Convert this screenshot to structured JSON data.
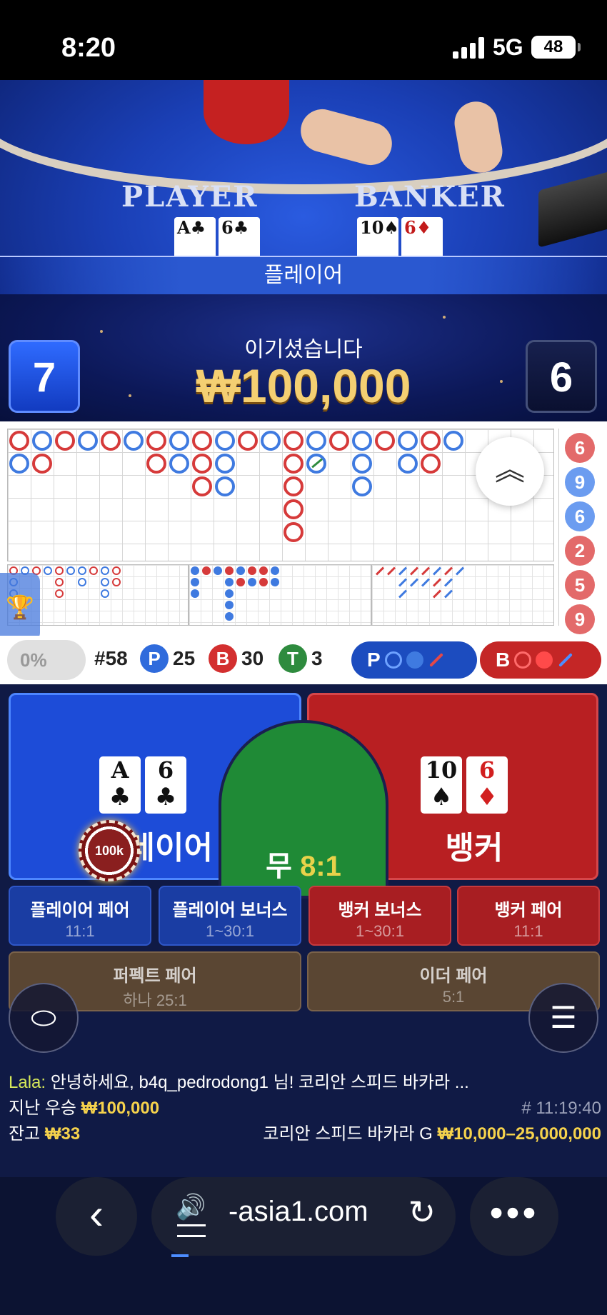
{
  "status_bar": {
    "time": "8:20",
    "network": "5G",
    "battery": "48"
  },
  "video": {
    "player_label": "PLAYER",
    "banker_label": "BANKER",
    "player_cards": [
      {
        "rank": "A",
        "suit": "♣",
        "color": "black"
      },
      {
        "rank": "6",
        "suit": "♣",
        "color": "black"
      }
    ],
    "banker_cards": [
      {
        "rank": "10",
        "suit": "♠",
        "color": "black"
      },
      {
        "rank": "6",
        "suit": "♦",
        "color": "red"
      }
    ],
    "result_banner": "플레이어",
    "win_text": "이기셨습니다",
    "win_amount": "₩100,000",
    "player_score": "7",
    "banker_score": "6"
  },
  "roadmap": {
    "big_road": [
      [
        "B",
        "P"
      ],
      [
        "P",
        "B"
      ],
      [
        "B"
      ],
      [
        "P"
      ],
      [
        "B"
      ],
      [
        "P"
      ],
      [
        "B",
        "B"
      ],
      [
        "P",
        "P"
      ],
      [
        "B",
        "B",
        "B"
      ],
      [
        "P",
        "P",
        "P"
      ],
      [
        "B"
      ],
      [
        "P"
      ],
      [
        "B",
        "B",
        "B",
        "B",
        "B"
      ],
      [
        "P",
        "T"
      ],
      [
        "B"
      ],
      [
        "P",
        "P",
        "P"
      ],
      [
        "B"
      ],
      [
        "P",
        "P"
      ],
      [
        "B",
        "B"
      ],
      [
        "P"
      ]
    ],
    "side_numbers": [
      {
        "value": "6",
        "color": "red"
      },
      {
        "value": "9",
        "color": "blue"
      },
      {
        "value": "6",
        "color": "blue"
      },
      {
        "value": "2",
        "color": "red"
      },
      {
        "value": "5",
        "color": "red"
      },
      {
        "value": "9",
        "color": "red"
      }
    ],
    "expand_icon": "double-chevron-up-icon",
    "trophy_icon": "trophy-icon"
  },
  "stats": {
    "percentage": "0%",
    "round": "#58",
    "player_letter": "P",
    "player_count": "25",
    "banker_letter": "B",
    "banker_count": "30",
    "tie_letter": "T",
    "tie_count": "3",
    "player_ask": "P",
    "banker_ask": "B"
  },
  "bets": {
    "player_label": "플레이어",
    "banker_label": "뱅커",
    "tie_label": "무",
    "tie_odds": "8:1",
    "chip_value": "100k",
    "player_cards": [
      {
        "rank": "A",
        "suit": "♣",
        "color": "black"
      },
      {
        "rank": "6",
        "suit": "♣",
        "color": "black"
      }
    ],
    "banker_cards": [
      {
        "rank": "10",
        "suit": "♠",
        "color": "black"
      },
      {
        "rank": "6",
        "suit": "♦",
        "color": "red"
      }
    ],
    "side_bets": [
      {
        "title": "플레이어 페어",
        "odds": "11:1"
      },
      {
        "title": "플레이어 보너스",
        "odds": "1~30:1"
      },
      {
        "title": "뱅커 보너스",
        "odds": "1~30:1"
      },
      {
        "title": "뱅커 페어",
        "odds": "11:1"
      }
    ],
    "perfect_pair": {
      "title": "퍼펙트 페어",
      "odds": "하나 25:1"
    },
    "either_pair": {
      "title": "이더 페어",
      "odds": "5:1"
    }
  },
  "chat": {
    "user": "Lala:",
    "message": "안녕하세요, b4q_pedrodong1 님! 코리안 스피드 바카라 ...",
    "last_win_label": "지난 우승",
    "last_win_amount": "₩100,000",
    "game_id": "# 11:19:40",
    "balance_label": "잔고",
    "balance_amount": "₩33",
    "table_name": "코리안 스피드 바카라 G",
    "limits": "₩10,000–25,000,000"
  },
  "browser": {
    "url": "-asia1.com",
    "back_icon": "back-arrow-icon",
    "speaker_icon": "speaker-icon",
    "reload_icon": "reload-icon",
    "more_icon": "more-icon"
  },
  "colors": {
    "player_blue": "#1d4cd8",
    "banker_red": "#b81f22",
    "tie_green": "#1f8a36",
    "gold": "#f5d24c"
  }
}
